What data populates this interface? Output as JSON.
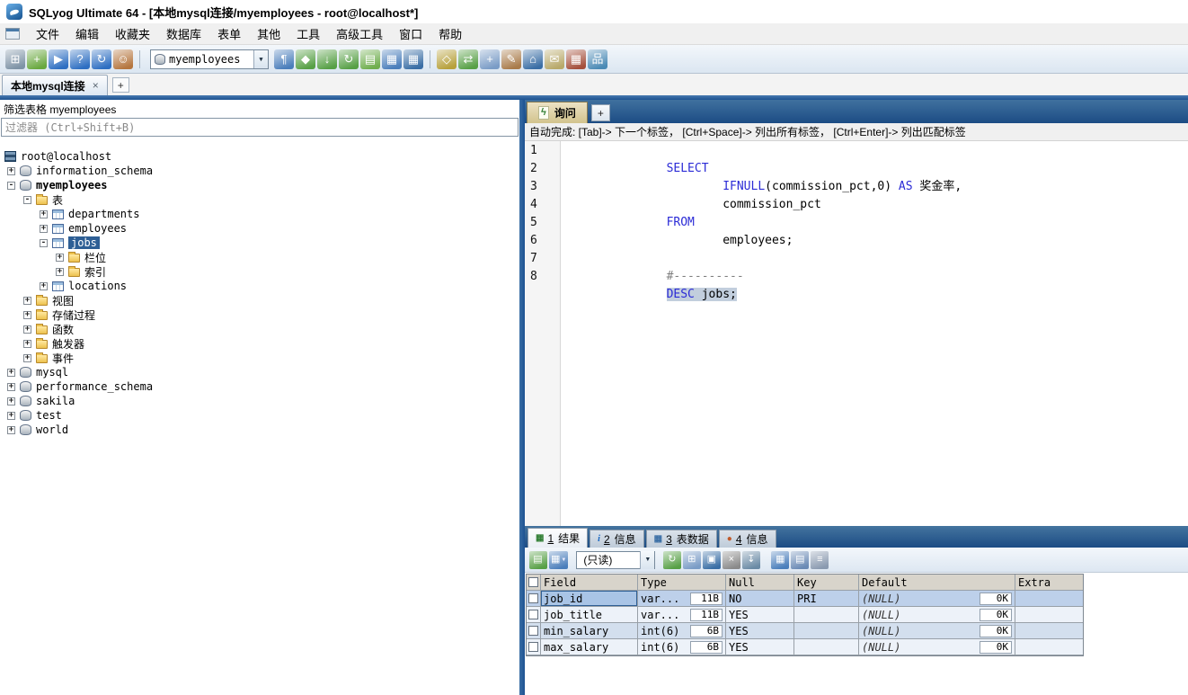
{
  "window": {
    "title": "SQLyog Ultimate 64 - [本地mysql连接/myemployees - root@localhost*]"
  },
  "menu": {
    "items": [
      {
        "name": "menu-file",
        "label": "文件"
      },
      {
        "name": "menu-edit",
        "label": "编辑"
      },
      {
        "name": "menu-favorites",
        "label": "收藏夹"
      },
      {
        "name": "menu-database",
        "label": "数据库"
      },
      {
        "name": "menu-table",
        "label": "表单"
      },
      {
        "name": "menu-others",
        "label": "其他"
      },
      {
        "name": "menu-tools",
        "label": "工具"
      },
      {
        "name": "menu-powertools",
        "label": "高级工具"
      },
      {
        "name": "menu-window",
        "label": "窗口"
      },
      {
        "name": "menu-help",
        "label": "帮助"
      }
    ]
  },
  "toolbar": {
    "group1": [
      {
        "name": "connect-icon",
        "glyph": "⊞",
        "bg": "#7e93a6"
      },
      {
        "name": "new-connection-icon",
        "glyph": "+",
        "bg": "#69a83e"
      },
      {
        "name": "execute-query-icon",
        "glyph": "▶",
        "bg": "#2e6fc2"
      },
      {
        "name": "explain-query-icon",
        "glyph": "?",
        "bg": "#2e6fc2"
      },
      {
        "name": "refresh-icon",
        "glyph": "↻",
        "bg": "#2e6fc2"
      },
      {
        "name": "user-manager-icon",
        "glyph": "☺",
        "bg": "#b5763f"
      }
    ],
    "database_select": {
      "value": "myemployees",
      "caret": "▼"
    },
    "group2": [
      {
        "name": "format-query-icon",
        "glyph": "¶",
        "bg": "#4a7ebb"
      },
      {
        "name": "create-database-icon",
        "glyph": "◆",
        "bg": "#57a046"
      },
      {
        "name": "backup-database-icon",
        "glyph": "↓",
        "bg": "#57a046"
      },
      {
        "name": "sync-database-icon",
        "glyph": "↻",
        "bg": "#57a046"
      },
      {
        "name": "open-table-icon",
        "glyph": "▤",
        "bg": "#6fae4e"
      },
      {
        "name": "insert-data-icon",
        "glyph": "▦",
        "bg": "#4a7ebb"
      },
      {
        "name": "table-data-icon",
        "glyph": "▦",
        "bg": "#3a6ea5"
      }
    ],
    "group3": [
      {
        "name": "schema-sync-icon",
        "glyph": "◇",
        "bg": "#b7a13c"
      },
      {
        "name": "data-sync-icon",
        "glyph": "⇄",
        "bg": "#57a046"
      },
      {
        "name": "new-table-icon",
        "glyph": "+",
        "bg": "#7a9cc6"
      },
      {
        "name": "alter-table-icon",
        "glyph": "✎",
        "bg": "#a97b4a"
      },
      {
        "name": "schema-designer-icon",
        "glyph": "⌂",
        "bg": "#3a6ea5"
      },
      {
        "name": "notification-services-icon",
        "glyph": "✉",
        "bg": "#b8a96a"
      },
      {
        "name": "query-profiler-icon",
        "glyph": "▦",
        "bg": "#a5503c"
      },
      {
        "name": "schema-optimizer-icon",
        "glyph": "品",
        "bg": "#4a8ab5"
      }
    ]
  },
  "connection_tab": {
    "label": "本地mysql连接",
    "close_glyph": "×",
    "add_glyph": "+"
  },
  "sidebar": {
    "filter_caption": "筛选表格 myemployees",
    "filter_placeholder": "过滤器 (Ctrl+Shift+B)",
    "tree": [
      {
        "label": "root@localhost",
        "depth": 0,
        "icon": "server",
        "exp": "none"
      },
      {
        "label": "information_schema",
        "depth": 1,
        "icon": "db",
        "exp": "plus"
      },
      {
        "label": "myemployees",
        "depth": 1,
        "icon": "db",
        "exp": "minus",
        "bold": true
      },
      {
        "label": "表",
        "depth": 2,
        "icon": "folder",
        "exp": "minus"
      },
      {
        "label": "departments",
        "depth": 3,
        "icon": "table",
        "exp": "plus"
      },
      {
        "label": "employees",
        "depth": 3,
        "icon": "table",
        "exp": "plus"
      },
      {
        "label": "jobs",
        "depth": 3,
        "icon": "table",
        "exp": "minus",
        "selected": true
      },
      {
        "label": "栏位",
        "depth": 4,
        "icon": "folder",
        "exp": "plus"
      },
      {
        "label": "索引",
        "depth": 4,
        "icon": "folder",
        "exp": "plus"
      },
      {
        "label": "locations",
        "depth": 3,
        "icon": "table",
        "exp": "plus"
      },
      {
        "label": "视图",
        "depth": 2,
        "icon": "folder",
        "exp": "plus"
      },
      {
        "label": "存储过程",
        "depth": 2,
        "icon": "folder",
        "exp": "plus"
      },
      {
        "label": "函数",
        "depth": 2,
        "icon": "folder",
        "exp": "plus"
      },
      {
        "label": "触发器",
        "depth": 2,
        "icon": "folder",
        "exp": "plus"
      },
      {
        "label": "事件",
        "depth": 2,
        "icon": "folder",
        "exp": "plus"
      },
      {
        "label": "mysql",
        "depth": 1,
        "icon": "db",
        "exp": "plus"
      },
      {
        "label": "performance_schema",
        "depth": 1,
        "icon": "db",
        "exp": "plus"
      },
      {
        "label": "sakila",
        "depth": 1,
        "icon": "db",
        "exp": "plus"
      },
      {
        "label": "test",
        "depth": 1,
        "icon": "db",
        "exp": "plus"
      },
      {
        "label": "world",
        "depth": 1,
        "icon": "db",
        "exp": "plus"
      }
    ]
  },
  "query": {
    "tab_label": "询问",
    "tab_icon": "ϟ",
    "add_glyph": "+",
    "hint": "自动完成: [Tab]-> 下一个标签， [Ctrl+Space]-> 列出所有标签， [Ctrl+Enter]-> 列出匹配标签",
    "lines": [
      {
        "num": 1,
        "segments": [
          {
            "text": "SELECT",
            "type": "kw"
          }
        ]
      },
      {
        "num": 2,
        "segments": [
          {
            "text": "        ",
            "type": "plain"
          },
          {
            "text": "IFNULL",
            "type": "kw"
          },
          {
            "text": "(commission_pct,0) ",
            "type": "plain"
          },
          {
            "text": "AS",
            "type": "kw"
          },
          {
            "text": " 奖金率,",
            "type": "plain"
          }
        ]
      },
      {
        "num": 3,
        "segments": [
          {
            "text": "        commission_pct",
            "type": "plain"
          }
        ]
      },
      {
        "num": 4,
        "segments": [
          {
            "text": "FROM",
            "type": "kw"
          }
        ]
      },
      {
        "num": 5,
        "segments": [
          {
            "text": "        employees;",
            "type": "plain"
          }
        ]
      },
      {
        "num": 6,
        "segments": []
      },
      {
        "num": 7,
        "segments": [
          {
            "text": "#----------",
            "type": "comment"
          }
        ]
      },
      {
        "num": 8,
        "segments": [
          {
            "text": "DESC",
            "type": "kw-sel"
          },
          {
            "text": " jobs;",
            "type": "plain-sel"
          }
        ]
      }
    ]
  },
  "results": {
    "tabs": [
      {
        "num": "1",
        "label": "结果",
        "icon": "▦",
        "active": true
      },
      {
        "num": "2",
        "label": "信息",
        "icon": "i",
        "active": false
      },
      {
        "num": "3",
        "label": "表数据",
        "icon": "▦",
        "active": false
      },
      {
        "num": "4",
        "label": "信息",
        "icon": "●",
        "active": false
      }
    ],
    "toolbar_a": [
      {
        "name": "export-grid-icon",
        "glyph": "▤",
        "bg": "#57a046"
      },
      {
        "name": "grid-options-icon",
        "glyph": "▦",
        "bg": "#4a7ebb",
        "caret": "▼"
      }
    ],
    "readonly_select": {
      "value": "(只读)",
      "caret": "▼"
    },
    "toolbar_b": [
      {
        "name": "refresh-grid-icon",
        "glyph": "↻",
        "bg": "#57a046"
      },
      {
        "name": "duplicate-row-icon",
        "glyph": "⊞",
        "bg": "#7a9cc6"
      },
      {
        "name": "save-changes-icon",
        "glyph": "▣",
        "bg": "#3a6ea5"
      },
      {
        "name": "delete-row-icon",
        "glyph": "×",
        "bg": "#8a8a8a"
      },
      {
        "name": "export-data-icon",
        "glyph": "↧",
        "bg": "#6a8aa5"
      }
    ],
    "toolbar_c": [
      {
        "name": "grid-view-icon",
        "glyph": "▦",
        "bg": "#4a7ebb"
      },
      {
        "name": "form-view-icon",
        "glyph": "▤",
        "bg": "#6a8ab5"
      },
      {
        "name": "text-view-icon",
        "glyph": "≡",
        "bg": "#8a9ab0"
      }
    ],
    "grid": {
      "columns": [
        "Field",
        "Type",
        "Null",
        "Key",
        "Default",
        "Extra"
      ],
      "rows": [
        {
          "field": "job_id",
          "type": "var...",
          "size": "11B",
          "nullable": "NO",
          "key": "PRI",
          "default": "(NULL)",
          "defsize": "0K",
          "extra": "",
          "selected": true
        },
        {
          "field": "job_title",
          "type": "var...",
          "size": "11B",
          "nullable": "YES",
          "key": "",
          "default": "(NULL)",
          "defsize": "0K",
          "extra": ""
        },
        {
          "field": "min_salary",
          "type": "int(6)",
          "size": "6B",
          "nullable": "YES",
          "key": "",
          "default": "(NULL)",
          "defsize": "0K",
          "extra": ""
        },
        {
          "field": "max_salary",
          "type": "int(6)",
          "size": "6B",
          "nullable": "YES",
          "key": "",
          "default": "(NULL)",
          "defsize": "0K",
          "extra": ""
        }
      ]
    }
  }
}
